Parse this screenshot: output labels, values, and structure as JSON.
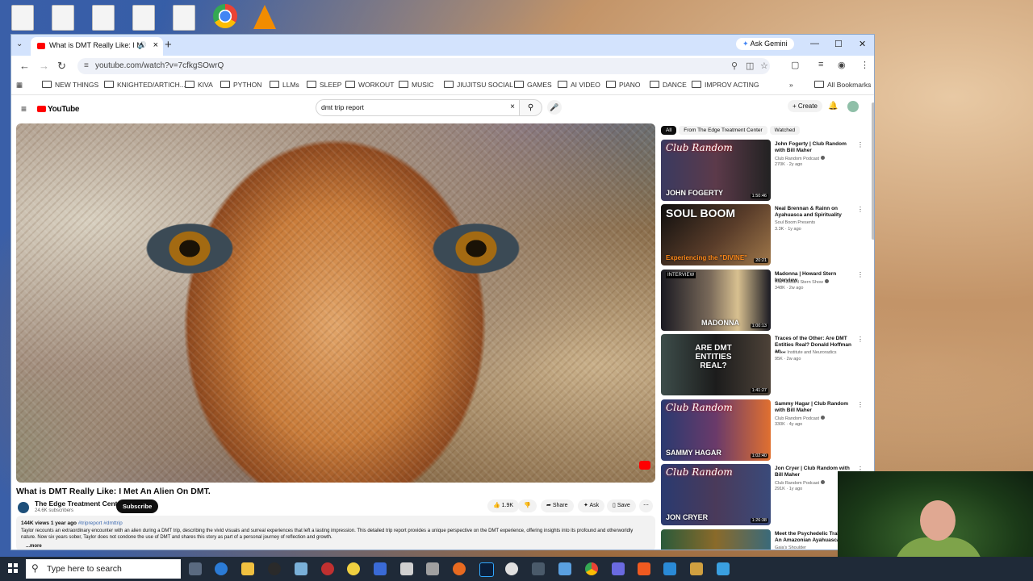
{
  "browser": {
    "tab_title": "What is DMT Really Like: I M",
    "ask_gemini": "Ask Gemini",
    "url": "youtube.com/watch?v=7cfkgSOwrQ",
    "bookmarks": [
      "NEW THINGS",
      "KNIGHTED/ARTICH...",
      "KIVA",
      "PYTHON",
      "LLMs",
      "SLEEP",
      "WORKOUT",
      "MUSIC",
      "JIUJITSU SOCIAL",
      "GAMES",
      "AI VIDEO",
      "PIANO",
      "DANCE",
      "IMPROV ACTING"
    ],
    "all_bookmarks": "All Bookmarks"
  },
  "youtube": {
    "logo_text": "YouTube",
    "search_query": "dmt trip report",
    "create_label": "Create",
    "video": {
      "title": "What is DMT Really Like: I Met An Alien On DMT.",
      "channel": "The Edge Treatment Center",
      "subscribers": "24.6K subscribers",
      "subscribe_label": "Subscribe",
      "likes": "1.9K",
      "share_label": "Share",
      "ask_label": "Ask",
      "save_label": "Save",
      "views": "144K views",
      "age": "1 year ago",
      "tags": "#tripreport #dmttrip",
      "description": "Taylor recounts an extraordinary encounter with an alien during a DMT trip, describing the vivid visuals and surreal experiences that left a lasting impression. This detailed trip report provides a unique perspective on the DMT experience, offering insights into its profound and otherworldly nature. Now six years sober, Taylor does not condone the use of DMT and shares this story as part of a personal journey of reflection and growth.",
      "more_label": "...more"
    },
    "chips": [
      "All",
      "From The Edge Treatment Center",
      "Watched"
    ],
    "recommendations": [
      {
        "title": "John Fogerty | Club Random with Bill Maher",
        "channel": "Club Random Podcast",
        "meta": "270K · 2y ago",
        "duration": "1:50:46",
        "overlay": "JOHN FOGERTY",
        "brand": "Club Random"
      },
      {
        "title": "Neal Brennan & Rainn on Ayahuasca and Spirituality",
        "channel": "Soul Boom Presents",
        "meta": "3.3K · 1y ago",
        "duration": "20:21",
        "overlay": "Experiencing the \"DIVINE\"",
        "brand": "SOUL BOOM"
      },
      {
        "title": "Madonna | Howard Stern Interview",
        "channel": "The Howard Stern Show",
        "meta": "348K · 2w ago",
        "duration": "1:00:13",
        "overlay": "MADONNA",
        "brand": "INTERVIEW"
      },
      {
        "title": "Traces of the Other: Are DMT Entities Real? Donald Hoffman an...",
        "channel": "Trace Institute and Neuroradics",
        "meta": "95K · 2w ago",
        "duration": "1:41:27",
        "overlay": "ARE DMT ENTITIES REAL?",
        "brand": ""
      },
      {
        "title": "Sammy Hagar | Club Random with Bill Maher",
        "channel": "Club Random Podcast",
        "meta": "330K · 4y ago",
        "duration": "1:02:40",
        "overlay": "SAMMY HAGAR",
        "brand": "Club Random"
      },
      {
        "title": "Jon Cryer | Club Random with Bill Maher",
        "channel": "Club Random Podcast",
        "meta": "291K · 1y ago",
        "duration": "1:26:38",
        "overlay": "JON CRYER",
        "brand": "Club Random"
      },
      {
        "title": "Meet the Psychedelic Trainer Be An Amazonian Ayahuasca",
        "channel": "Gaia's Shoulder",
        "meta": "",
        "duration": "",
        "overlay": "",
        "brand": ""
      }
    ]
  },
  "taskbar": {
    "search_placeholder": "Type here to search"
  }
}
